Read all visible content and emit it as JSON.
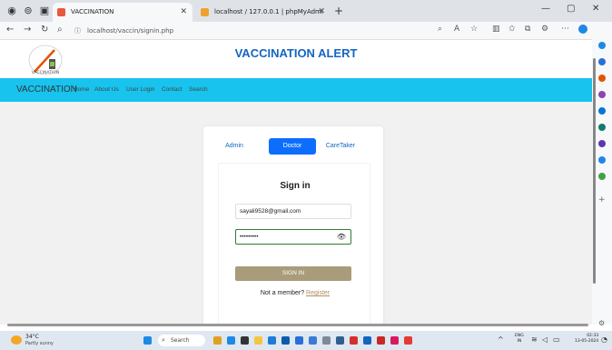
{
  "browser": {
    "tabs": [
      {
        "title": "VACCINATION",
        "active": true
      },
      {
        "title": "localhost / 127.0.0.1 | phpMyAdmi",
        "active": false
      }
    ],
    "new_tab": "+",
    "url": "localhost/vaccin/signin.php",
    "window": {
      "minimize": "—",
      "maximize": "▢",
      "close": "✕"
    }
  },
  "site": {
    "logo_text": "VACCINATION",
    "title": "VACCINATION ALERT",
    "brand": "VACCINATION",
    "nav": [
      "Home",
      "About Us",
      "User Login",
      "Contact",
      "Search"
    ]
  },
  "login": {
    "tabs": [
      "Admin",
      "Doctor",
      "CareTaker"
    ],
    "active_tab": "Doctor",
    "heading": "Sign in",
    "email_value": "sayali9528@gmail.com",
    "password_value": "•••••••••",
    "button_label": "SIGN IN",
    "member_text": "Not a member? ",
    "register_link": "Register"
  },
  "taskbar": {
    "weather_temp": "34°C",
    "weather_desc": "Partly sunny",
    "search_placeholder": "Search",
    "lang_top": "ENG",
    "lang_bottom": "IN",
    "time": "02:33",
    "date": "13-05-2024"
  },
  "colors": {
    "title_blue": "#1565c0",
    "nav_cyan": "#18c3ee",
    "active_tab_blue": "#0d6efd",
    "signin_button": "#a89c7a",
    "register_link": "#b08c60"
  }
}
